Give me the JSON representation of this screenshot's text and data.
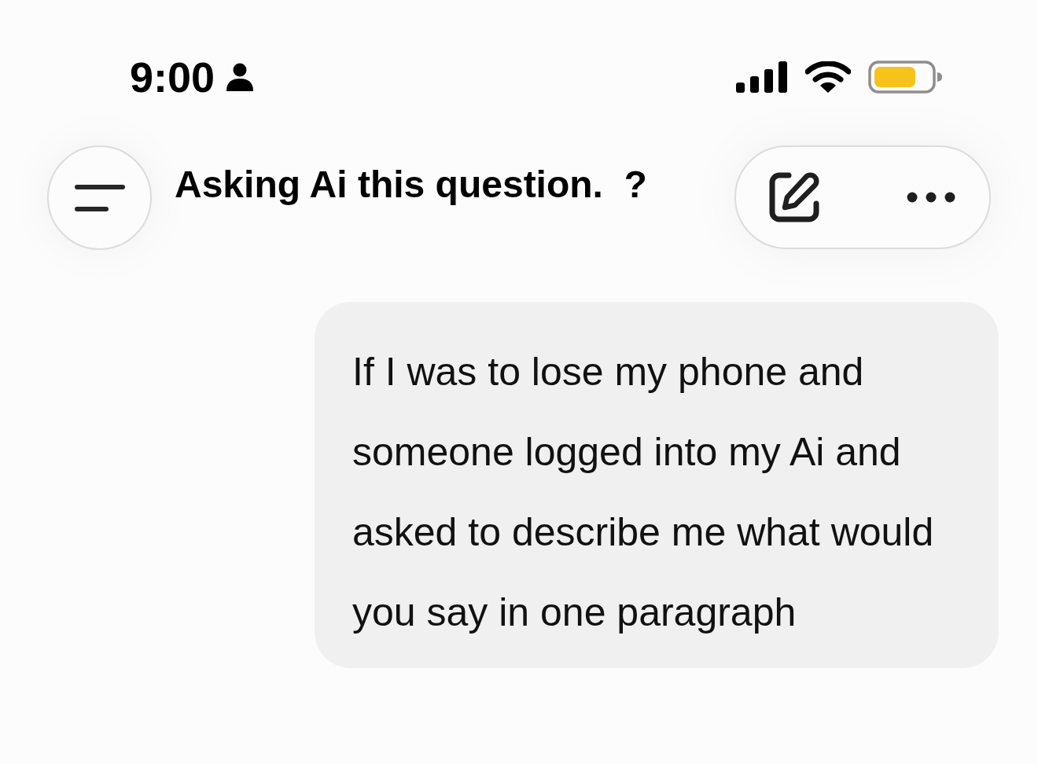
{
  "status_bar": {
    "time": "9:00"
  },
  "header": {
    "title": "Asking Ai this question.  ?"
  },
  "messages": [
    {
      "text": "If I was to lose my phone and someone logged into my Ai and asked to describe me what would you say in one paragraph"
    }
  ]
}
